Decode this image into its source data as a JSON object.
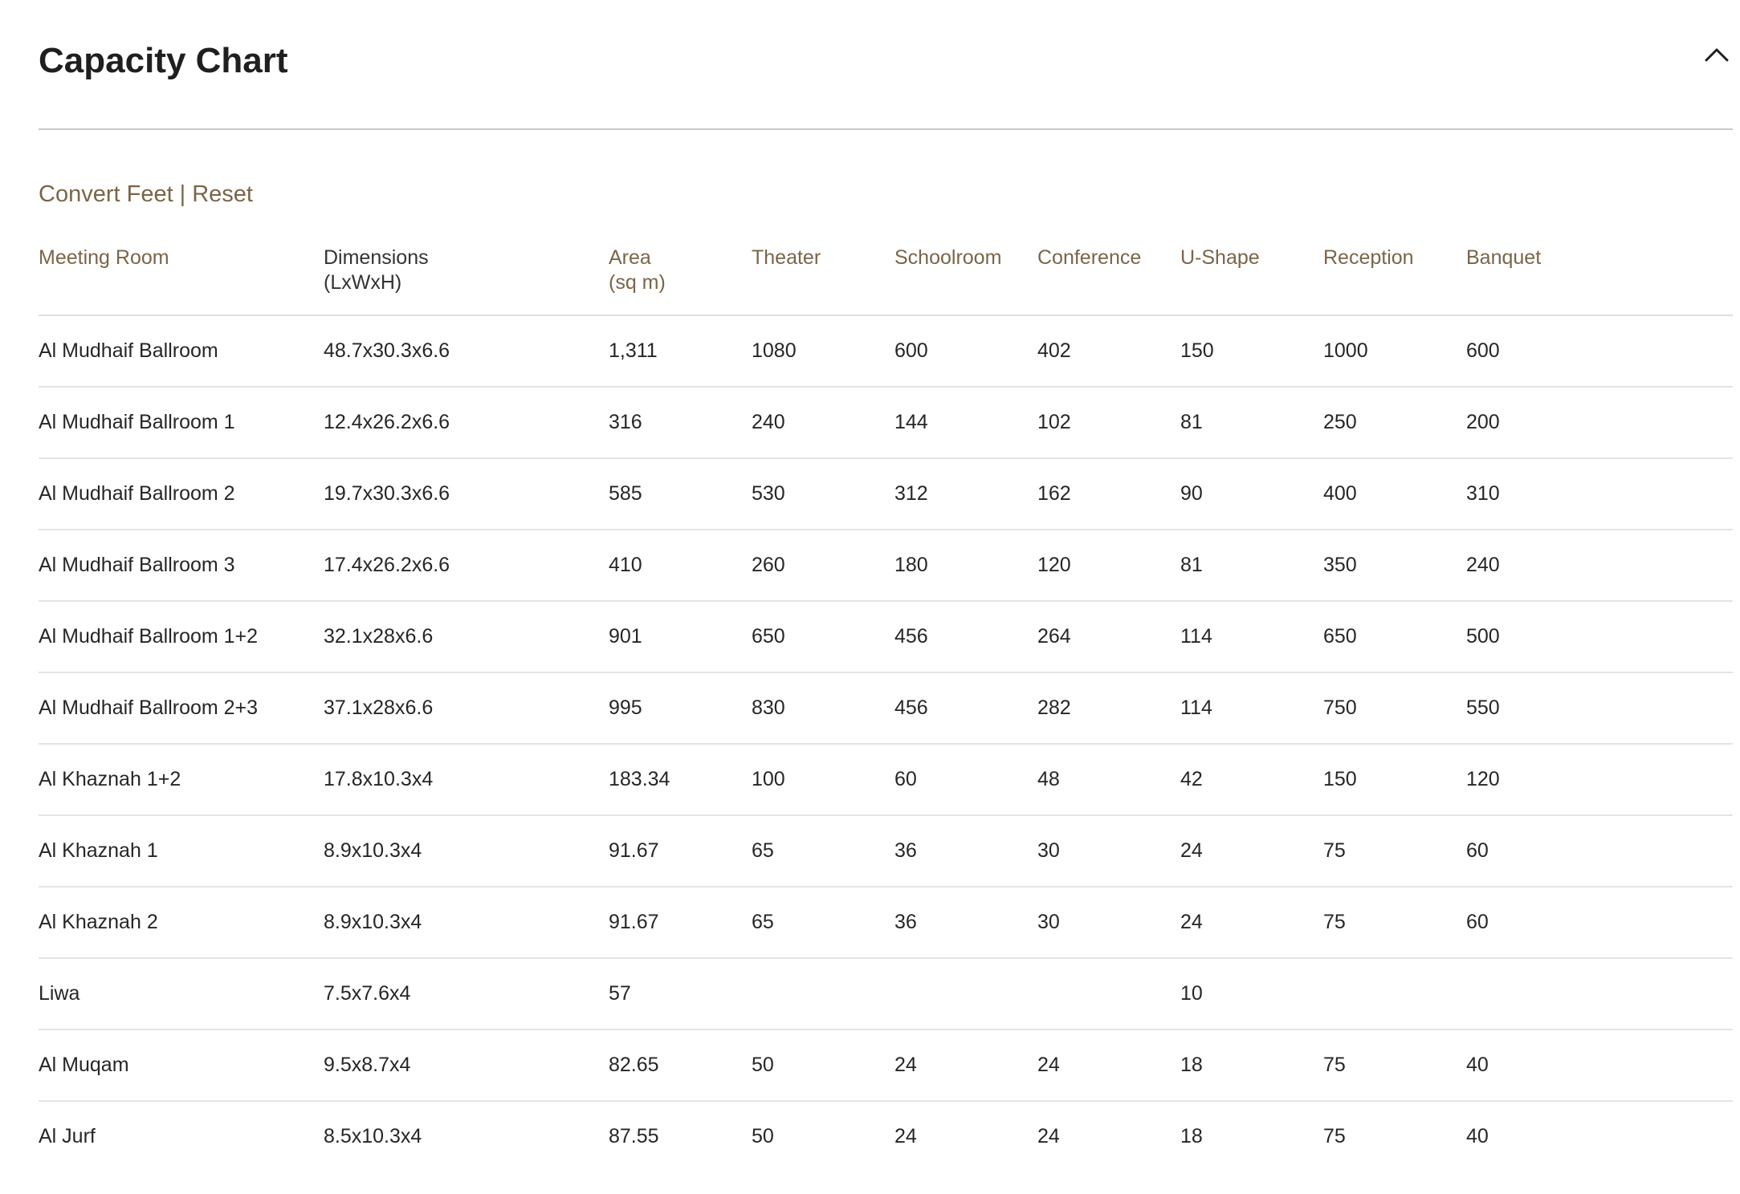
{
  "header": {
    "title": "Capacity Chart",
    "collapse_icon": "chevron-up-icon"
  },
  "units": {
    "convert_label": "Convert Feet",
    "separator": "|",
    "reset_label": "Reset"
  },
  "table": {
    "columns": [
      {
        "line1": "Meeting Room",
        "line2": ""
      },
      {
        "line1": "Dimensions",
        "line2": "(LxWxH)"
      },
      {
        "line1": "Area",
        "line2": "(sq m)"
      },
      {
        "line1": "Theater",
        "line2": ""
      },
      {
        "line1": "Schoolroom",
        "line2": ""
      },
      {
        "line1": "Conference",
        "line2": ""
      },
      {
        "line1": "U-Shape",
        "line2": ""
      },
      {
        "line1": "Reception",
        "line2": ""
      },
      {
        "line1": "Banquet",
        "line2": ""
      }
    ],
    "rows": [
      [
        "Al Mudhaif Ballroom",
        "48.7x30.3x6.6",
        "1,311",
        "1080",
        "600",
        "402",
        "150",
        "1000",
        "600"
      ],
      [
        "Al Mudhaif Ballroom 1",
        "12.4x26.2x6.6",
        "316",
        "240",
        "144",
        "102",
        "81",
        "250",
        "200"
      ],
      [
        "Al Mudhaif Ballroom 2",
        "19.7x30.3x6.6",
        "585",
        "530",
        "312",
        "162",
        "90",
        "400",
        "310"
      ],
      [
        "Al Mudhaif Ballroom 3",
        "17.4x26.2x6.6",
        "410",
        "260",
        "180",
        "120",
        "81",
        "350",
        "240"
      ],
      [
        "Al Mudhaif Ballroom 1+2",
        "32.1x28x6.6",
        "901",
        "650",
        "456",
        "264",
        "114",
        "650",
        "500"
      ],
      [
        "Al Mudhaif Ballroom 2+3",
        "37.1x28x6.6",
        "995",
        "830",
        "456",
        "282",
        "114",
        "750",
        "550"
      ],
      [
        "Al Khaznah 1+2",
        "17.8x10.3x4",
        "183.34",
        "100",
        "60",
        "48",
        "42",
        "150",
        "120"
      ],
      [
        "Al Khaznah 1",
        "8.9x10.3x4",
        "91.67",
        "65",
        "36",
        "30",
        "24",
        "75",
        "60"
      ],
      [
        "Al Khaznah 2",
        "8.9x10.3x4",
        "91.67",
        "65",
        "36",
        "30",
        "24",
        "75",
        "60"
      ],
      [
        "Liwa",
        "7.5x7.6x4",
        "57",
        "",
        "",
        "",
        "10",
        "",
        ""
      ],
      [
        "Al Muqam",
        "9.5x8.7x4",
        "82.65",
        "50",
        "24",
        "24",
        "18",
        "75",
        "40"
      ],
      [
        "Al Jurf",
        "8.5x10.3x4",
        "87.55",
        "50",
        "24",
        "24",
        "18",
        "75",
        "40"
      ]
    ]
  }
}
